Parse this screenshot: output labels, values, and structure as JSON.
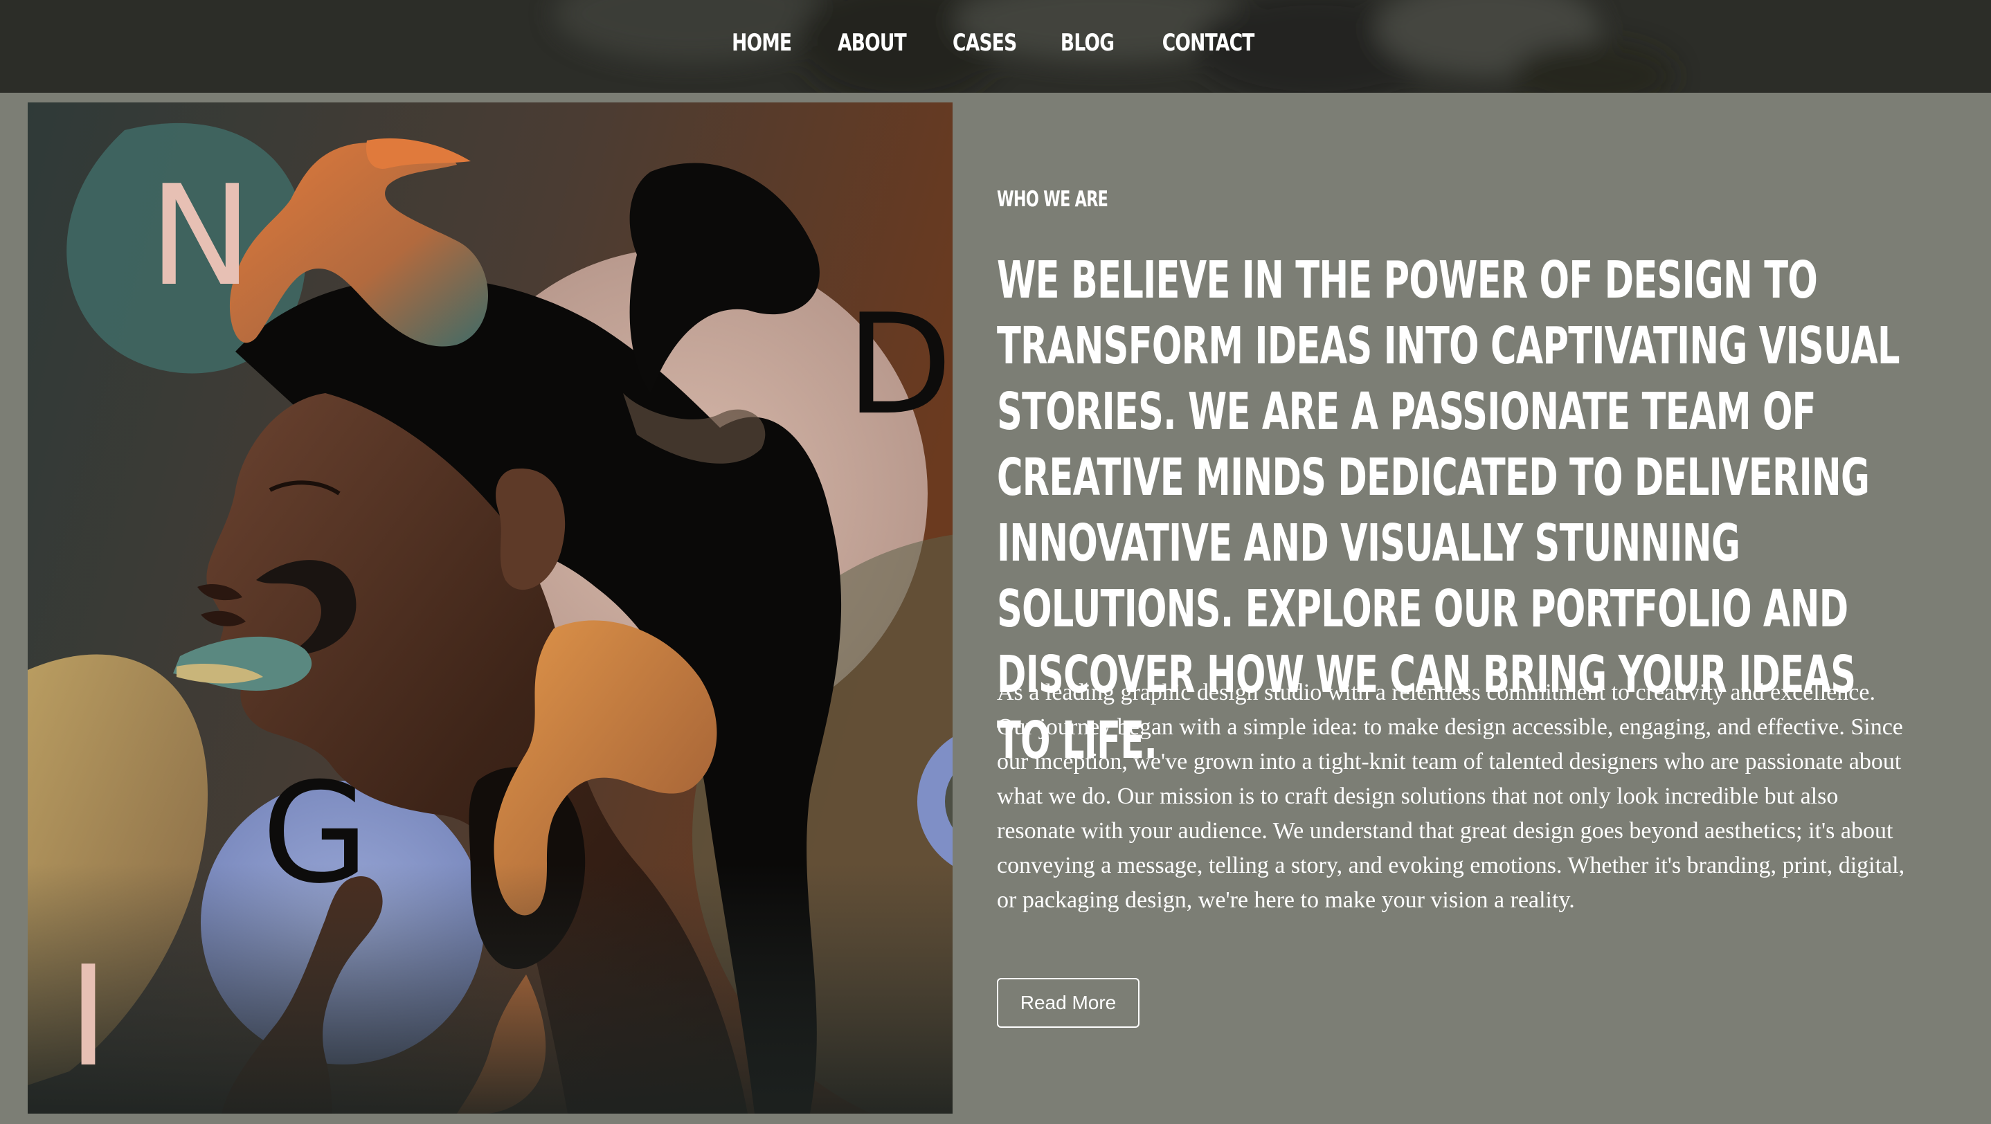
{
  "nav": {
    "items": [
      {
        "label": "HOME"
      },
      {
        "label": "ABOUT"
      },
      {
        "label": "CASES"
      },
      {
        "label": "BLOG"
      },
      {
        "label": "CONTACT"
      }
    ]
  },
  "hero": {
    "letters": [
      "N",
      "D",
      "G",
      "I",
      "O"
    ]
  },
  "about": {
    "eyebrow": "WHO WE ARE",
    "headline": "WE BELIEVE IN THE POWER OF DESIGN TO TRANSFORM IDEAS INTO CAPTIVATING VISUAL STORIES. WE ARE A PASSIONATE TEAM OF CREATIVE MINDS DEDICATED TO DELIVERING INNOVATIVE AND VISUALLY STUNNING SOLUTIONS. EXPLORE OUR PORTFOLIO AND DISCOVER HOW WE CAN BRING YOUR IDEAS TO LIFE.",
    "body": "As a leading graphic design studio with a relentless commitment to creativity and excellence. Our journey began with a simple idea: to make design accessible, engaging, and effective. Since our inception, we've grown into a tight-knit team of talented designers who are passionate about what we do. Our mission is to craft design solutions that not only look incredible but also resonate with your audience. We understand that great design goes beyond aesthetics; it's about conveying a message, telling a story, and evoking emotions. Whether it's branding, print, digital, or packaging design, we're here to make your vision a reality.",
    "button_label": "Read More"
  },
  "colors": {
    "page_bg": "#7c7e75",
    "nav_bg": "#2c2d28",
    "text": "#ffffff"
  }
}
